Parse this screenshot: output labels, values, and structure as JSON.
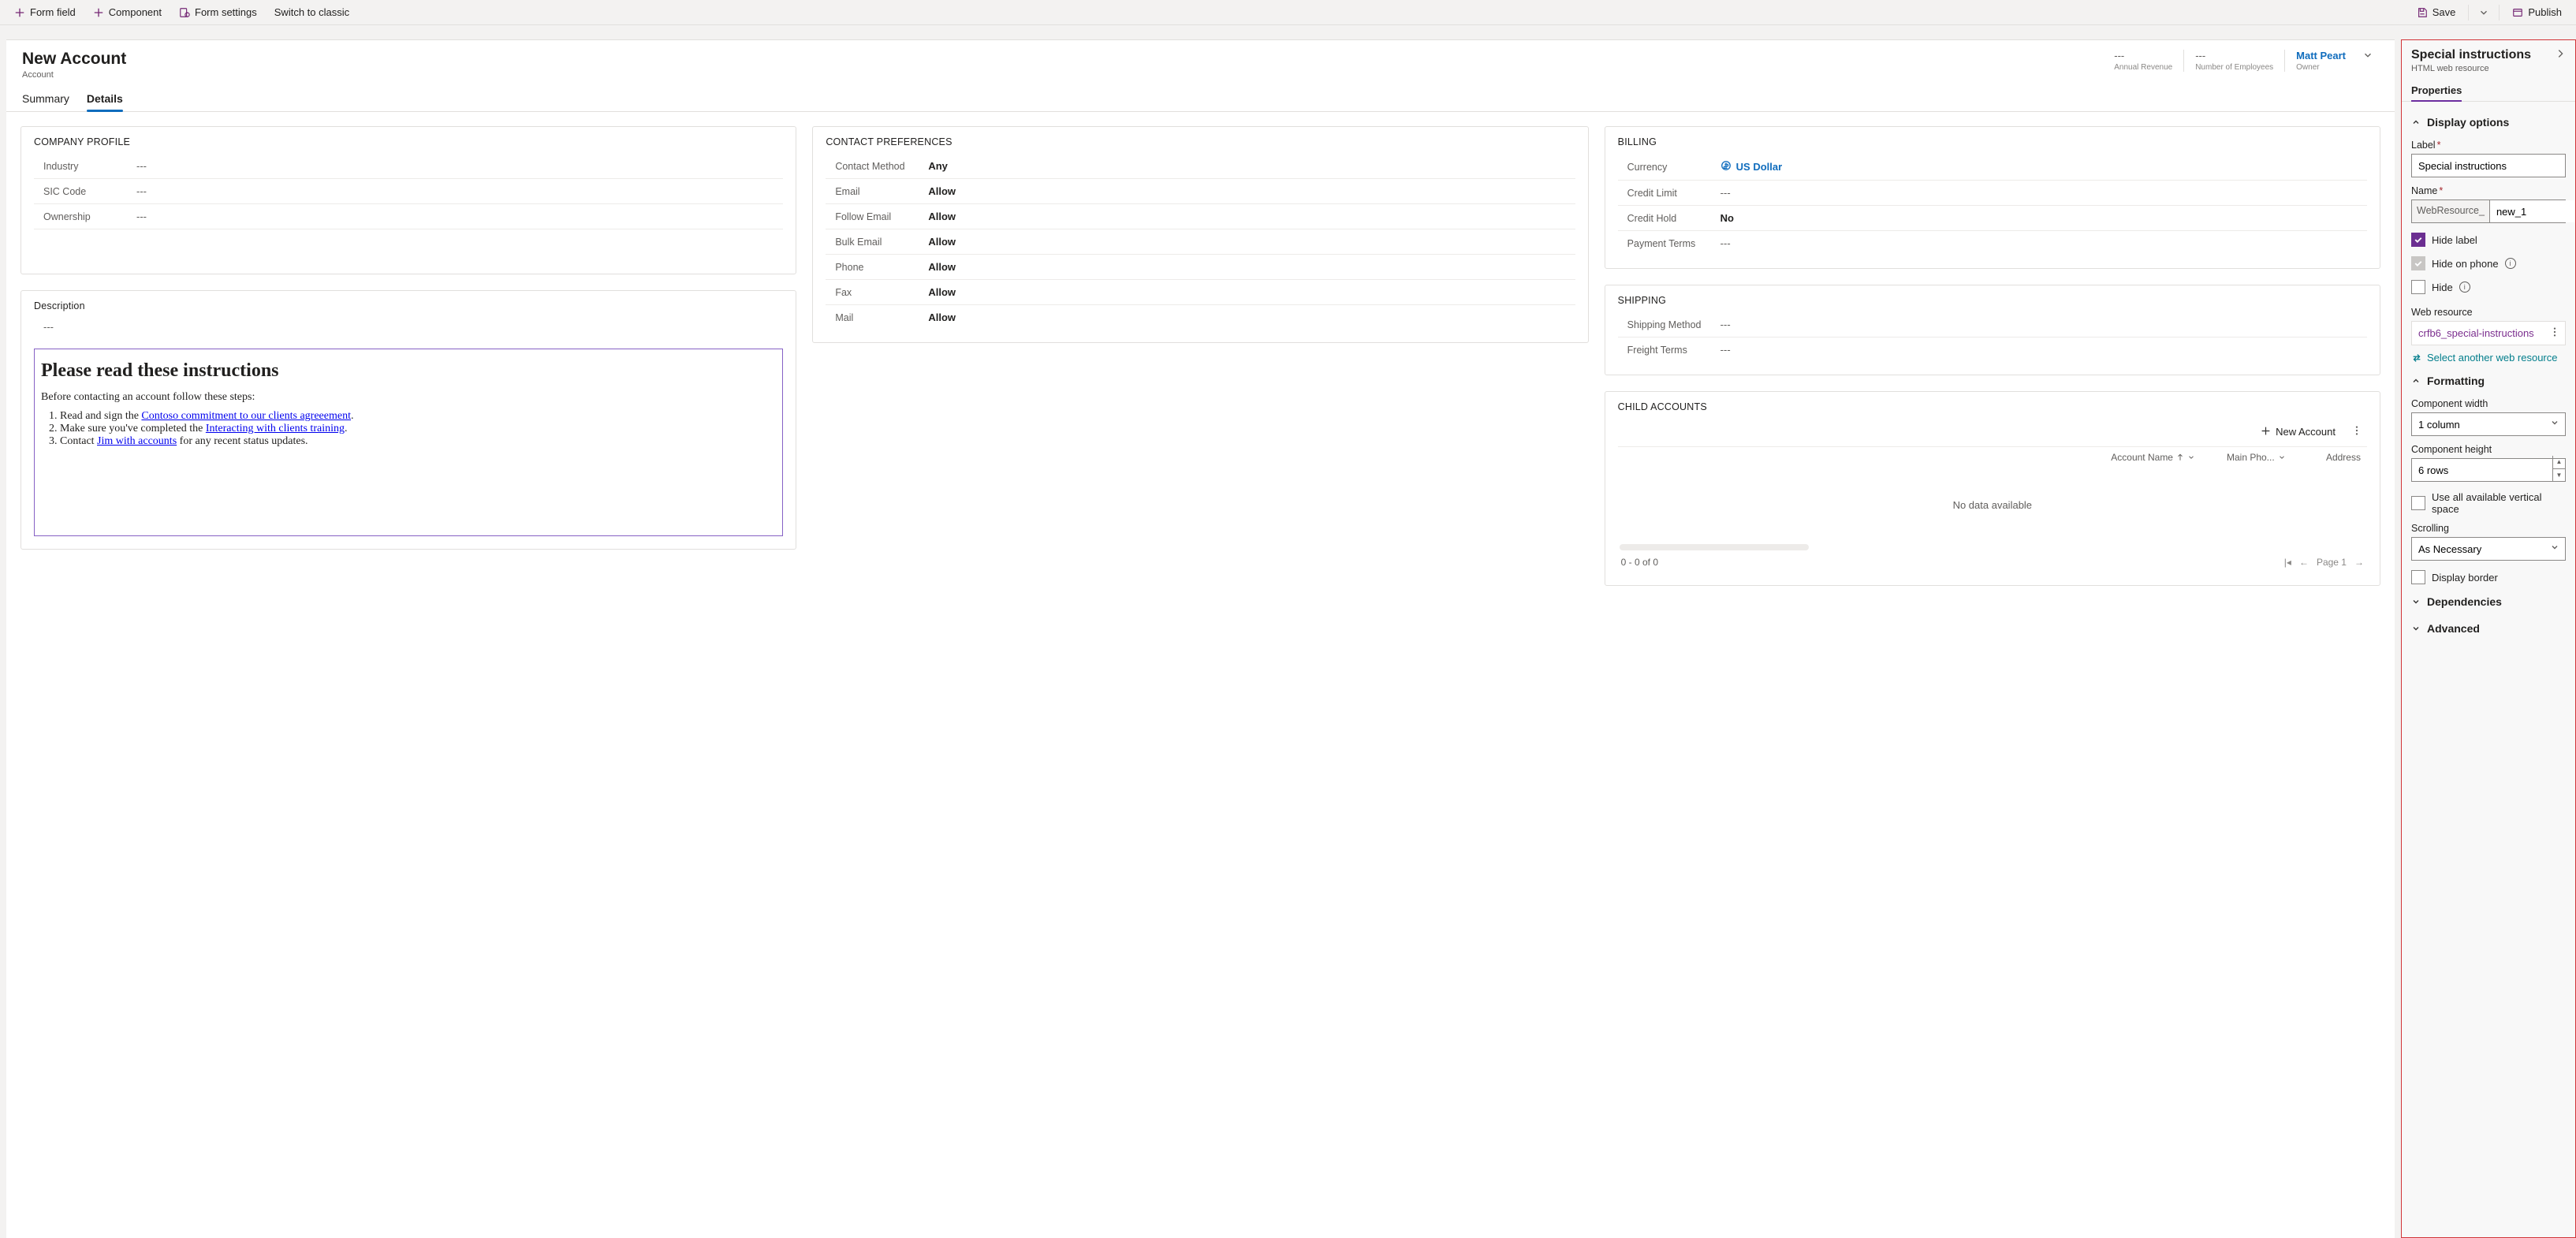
{
  "cmdbar": {
    "form_field": "Form field",
    "component": "Component",
    "form_settings": "Form settings",
    "switch_classic": "Switch to classic",
    "save": "Save",
    "publish": "Publish"
  },
  "form": {
    "title": "New Account",
    "entity": "Account",
    "stats": {
      "revenue_value": "---",
      "revenue_label": "Annual Revenue",
      "employees_value": "---",
      "employees_label": "Number of Employees",
      "owner_value": "Matt Peart",
      "owner_label": "Owner"
    },
    "tabs": {
      "summary": "Summary",
      "details": "Details"
    }
  },
  "sections": {
    "company_profile": {
      "title": "COMPANY PROFILE",
      "industry_l": "Industry",
      "industry_v": "---",
      "sic_l": "SIC Code",
      "sic_v": "---",
      "ownership_l": "Ownership",
      "ownership_v": "---"
    },
    "description": {
      "title": "Description",
      "value": "---",
      "wr_heading": "Please read these instructions",
      "wr_intro": "Before contacting an account follow these steps:",
      "wr_step1_pre": "Read and sign the ",
      "wr_step1_link": "Contoso commitment to our clients agreeement",
      "wr_step1_post": ".",
      "wr_step2_pre": "Make sure you've completed the ",
      "wr_step2_link": "Interacting with clients training",
      "wr_step2_post": ".",
      "wr_step3_pre": "Contact ",
      "wr_step3_link": "Jim with accounts",
      "wr_step3_post": " for any recent status updates."
    },
    "contact_prefs": {
      "title": "CONTACT PREFERENCES",
      "method_l": "Contact Method",
      "method_v": "Any",
      "email_l": "Email",
      "email_v": "Allow",
      "femail_l": "Follow Email",
      "femail_v": "Allow",
      "bulk_l": "Bulk Email",
      "bulk_v": "Allow",
      "phone_l": "Phone",
      "phone_v": "Allow",
      "fax_l": "Fax",
      "fax_v": "Allow",
      "mail_l": "Mail",
      "mail_v": "Allow"
    },
    "billing": {
      "title": "BILLING",
      "currency_l": "Currency",
      "currency_v": "US Dollar",
      "limit_l": "Credit Limit",
      "limit_v": "---",
      "hold_l": "Credit Hold",
      "hold_v": "No",
      "terms_l": "Payment Terms",
      "terms_v": "---"
    },
    "shipping": {
      "title": "SHIPPING",
      "method_l": "Shipping Method",
      "method_v": "---",
      "freight_l": "Freight Terms",
      "freight_v": "---"
    },
    "child": {
      "title": "CHILD ACCOUNTS",
      "new_btn": "New Account",
      "col_account": "Account Name",
      "col_phone": "Main Pho...",
      "col_address": "Address",
      "empty": "No data available",
      "count": "0 - 0 of 0",
      "page": "Page 1"
    }
  },
  "props": {
    "title": "Special instructions",
    "subtitle": "HTML web resource",
    "tab": "Properties",
    "display_options": "Display options",
    "label_l": "Label",
    "label_v": "Special instructions",
    "name_l": "Name",
    "name_prefix": "WebResource_",
    "name_v": "new_1",
    "hide_label": "Hide label",
    "hide_phone": "Hide on phone",
    "hide": "Hide",
    "webres_l": "Web resource",
    "webres_v": "crfb6_special-instructions",
    "select_another": "Select another web resource",
    "formatting": "Formatting",
    "width_l": "Component width",
    "width_v": "1 column",
    "height_l": "Component height",
    "height_v": "6 rows",
    "use_space": "Use all available vertical space",
    "scrolling_l": "Scrolling",
    "scrolling_v": "As Necessary",
    "display_border": "Display border",
    "dependencies": "Dependencies",
    "advanced": "Advanced"
  }
}
